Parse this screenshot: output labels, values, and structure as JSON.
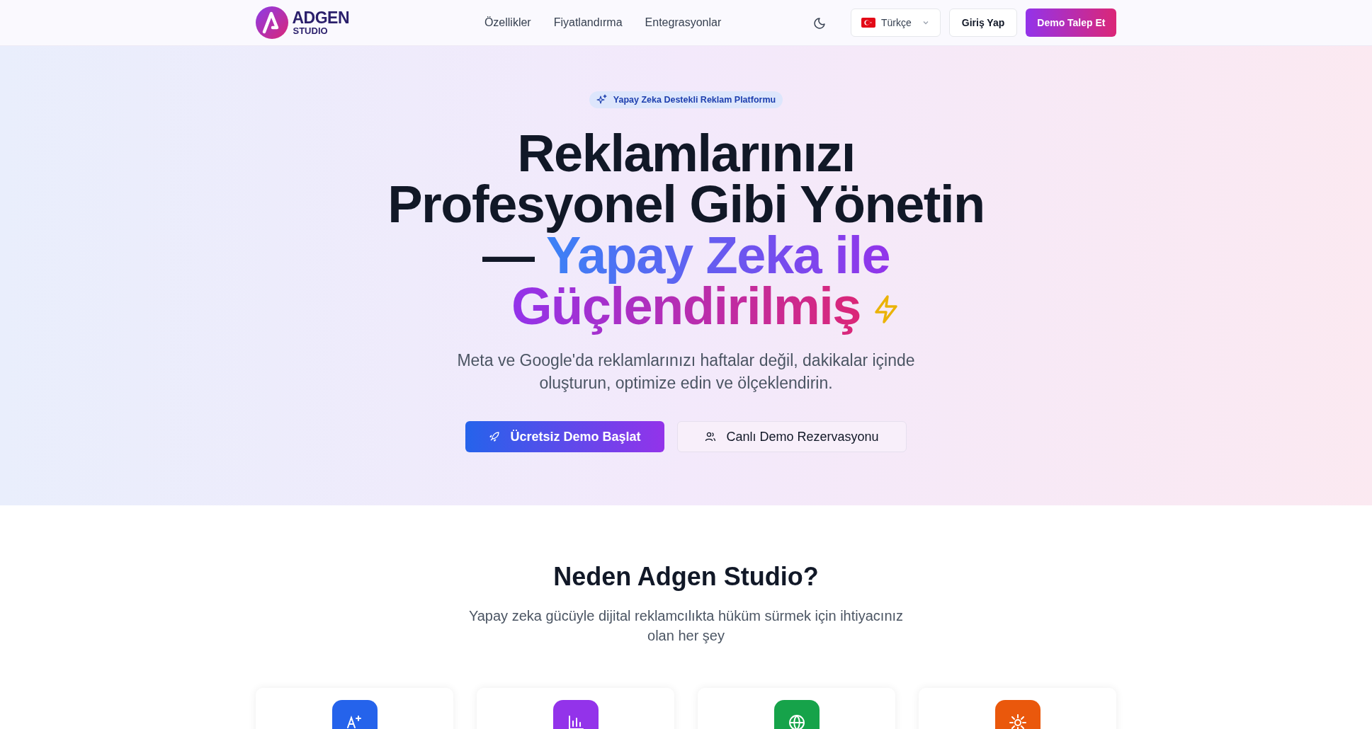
{
  "header": {
    "logo": {
      "name": "ADGEN",
      "sub": "STUDIO"
    },
    "nav": [
      {
        "label": "Özellikler"
      },
      {
        "label": "Fiyatlandırma"
      },
      {
        "label": "Entegrasyonlar"
      }
    ],
    "language": {
      "label": "Türkçe"
    },
    "login": "Giriş Yap",
    "cta": "Demo Talep Et"
  },
  "hero": {
    "badge": "Yapay Zeka Destekli Reklam Platformu",
    "title": "Reklamlarınızı Profesyonel Gibi Yönetin —",
    "title_highlight": "Yapay Zeka ile Güçlendirilmiş",
    "subtitle": "Meta ve Google'da reklamlarınızı haftalar değil, dakikalar içinde oluşturun, optimize edin ve ölçeklendirin.",
    "buttons": [
      {
        "label": "Ücretsiz Demo Başlat",
        "kind": "primary"
      },
      {
        "label": "Canlı Demo Rezervasyonu",
        "kind": "secondary"
      }
    ]
  },
  "features": {
    "title": "Neden Adgen Studio?",
    "subtitle": "Yapay zeka gücüyle dijital reklamcılıkta hüküm sürmek için ihtiyacınız olan her şey",
    "cards": [
      {
        "color": "#2563eb"
      },
      {
        "color": "#9333ea"
      },
      {
        "color": "#16a34a"
      },
      {
        "color": "#ea580c"
      }
    ]
  }
}
